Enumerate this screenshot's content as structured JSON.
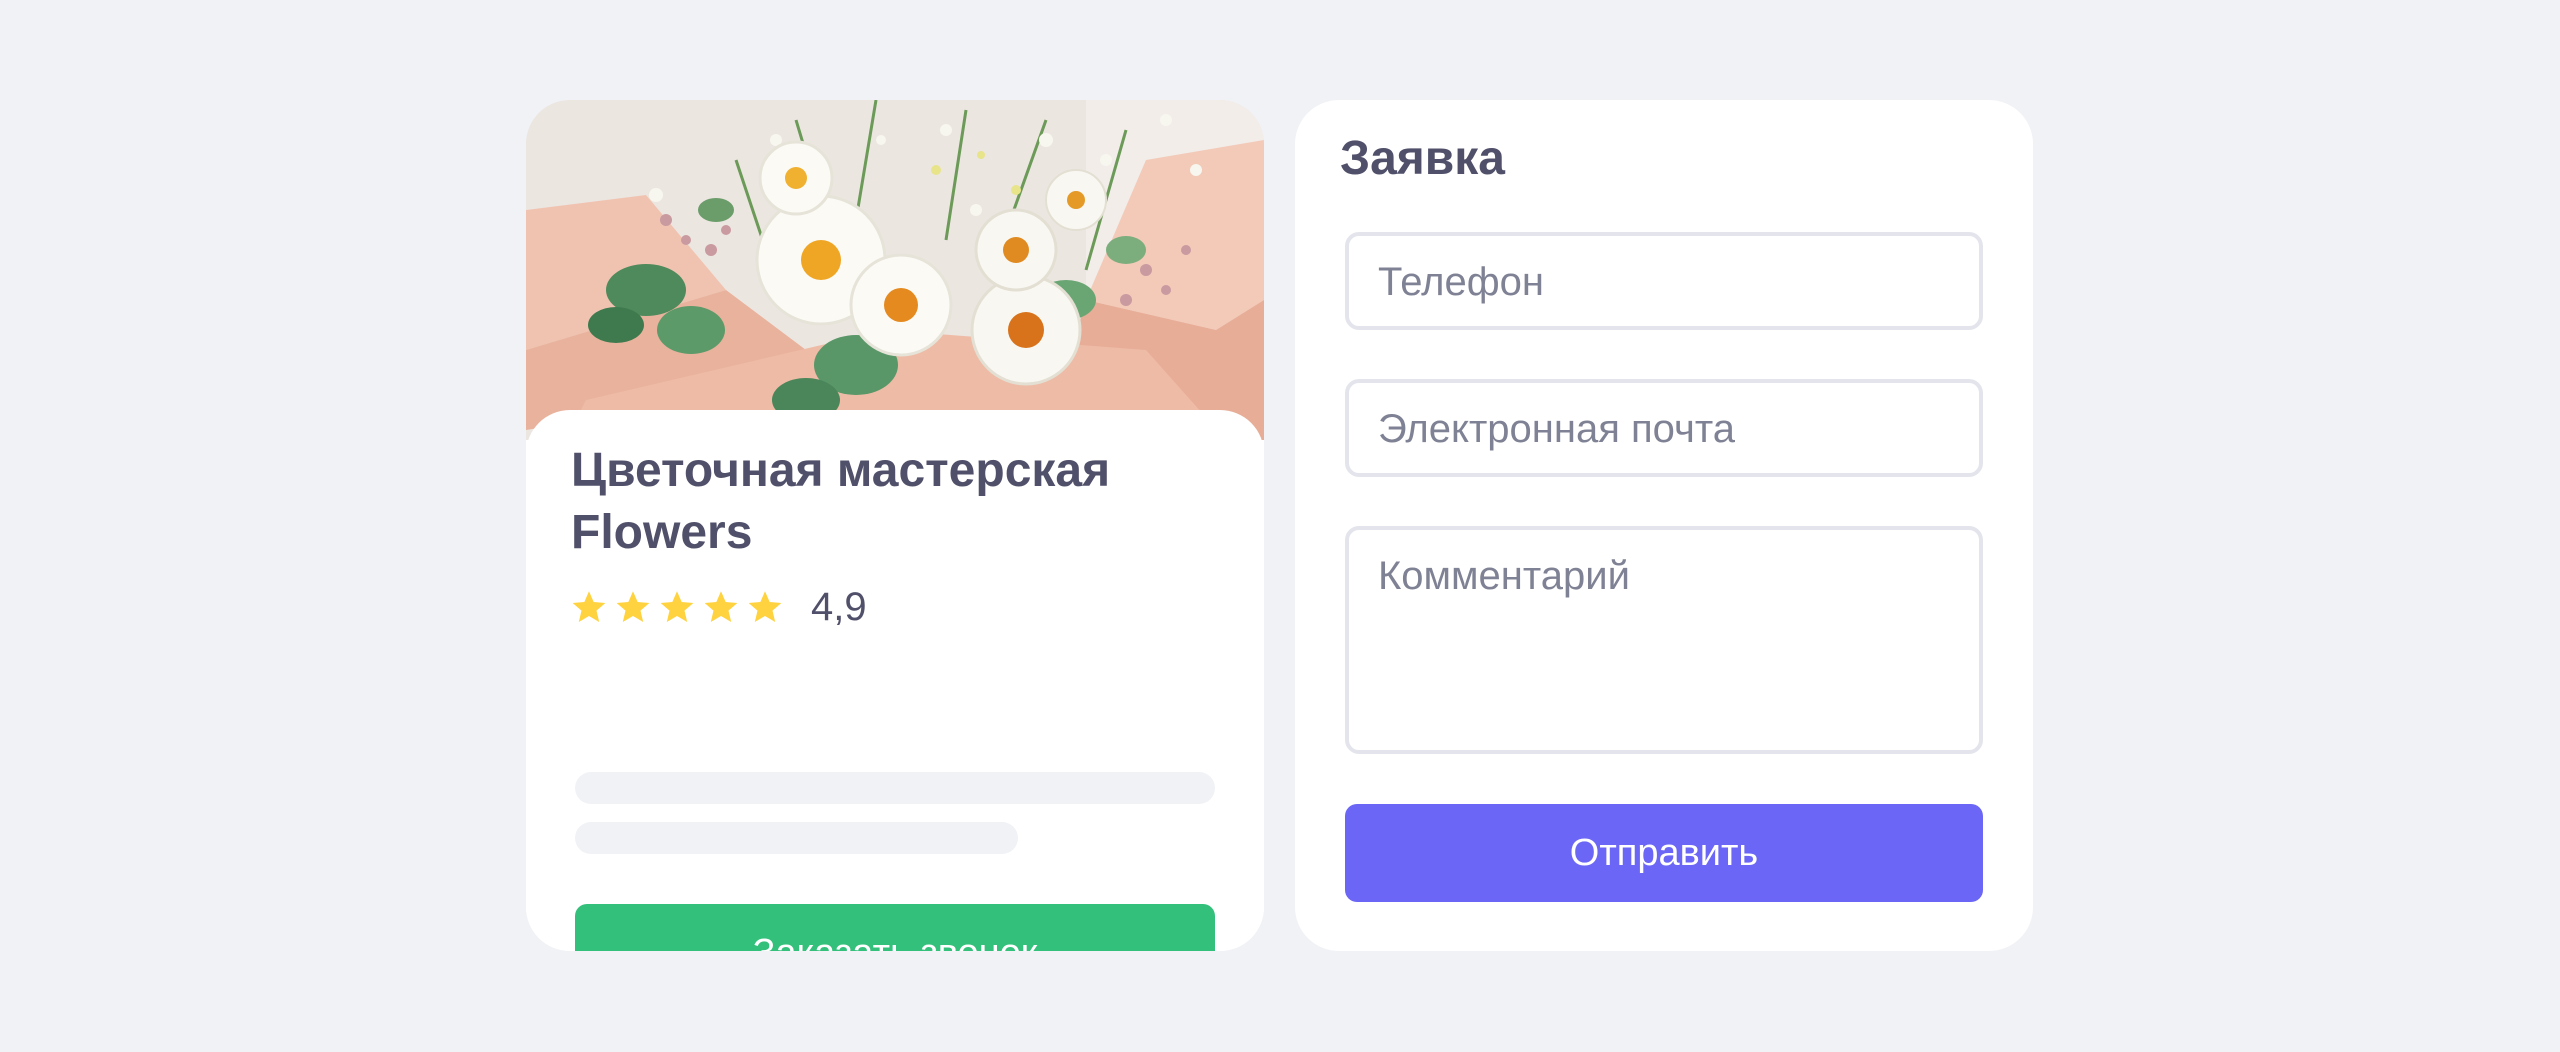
{
  "shop_card": {
    "title": "Цветочная мастерская Flowers",
    "rating": {
      "stars": 5,
      "value": "4,9",
      "star_color": "#ffd23f"
    },
    "call_button_label": "Заказать звонок",
    "call_button_color": "#33c07b"
  },
  "request_form": {
    "title": "Заявка",
    "phone_placeholder": "Телефон",
    "email_placeholder": "Электронная почта",
    "comment_placeholder": "Комментарий",
    "submit_label": "Отправить",
    "submit_color": "#6b66f5"
  },
  "colors": {
    "background": "#f1f2f6",
    "card": "#ffffff",
    "text": "#50506a",
    "placeholder": "#7f8294"
  }
}
